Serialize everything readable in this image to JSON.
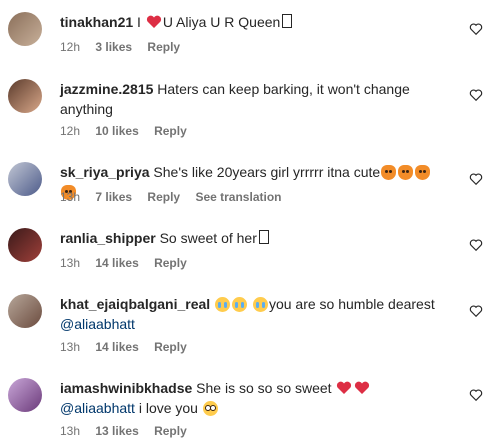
{
  "colors": {
    "text": "#262626",
    "secondary": "#737373",
    "mention": "#00376b",
    "heart_red": "#ed4956"
  },
  "comments": [
    {
      "username": "tinakhan21",
      "text_before": "I",
      "text_after": "U Aliya U R Queen",
      "time": "12h",
      "likes": "3 likes",
      "reply": "Reply"
    },
    {
      "username": "jazzmine.2815",
      "text": "Haters can keep barking, it won't change anything",
      "time": "12h",
      "likes": "10 likes",
      "reply": "Reply"
    },
    {
      "username": "sk_riya_priya",
      "text": "She's like 20years girl yrrrrr itna cute",
      "time": "13h",
      "likes": "7 likes",
      "reply": "Reply",
      "translate": "See translation"
    },
    {
      "username": "ranlia_shipper",
      "text": "So sweet of her",
      "time": "13h",
      "likes": "14 likes",
      "reply": "Reply"
    },
    {
      "username": "khat_ejaiqbalgani_real",
      "text": "you are so humble dearest",
      "mention": "@aliaabhatt",
      "time": "13h",
      "likes": "14 likes",
      "reply": "Reply"
    },
    {
      "username": "iamashwinibkhadse",
      "text_before": "She is so so so sweet",
      "mention": "@aliaabhatt",
      "text_after": "i love you",
      "time": "13h",
      "likes": "13 likes",
      "reply": "Reply"
    }
  ]
}
